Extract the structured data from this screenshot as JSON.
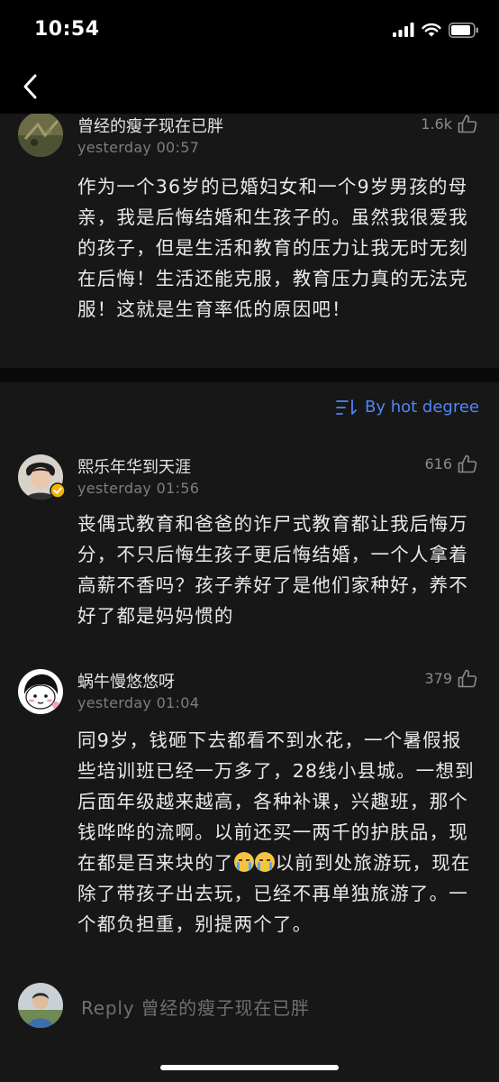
{
  "status": {
    "time": "10:54"
  },
  "nav": {
    "back_icon": "chevron-left-icon"
  },
  "parent_comment": {
    "author": "曾经的瘦子现在已胖",
    "date": "yesterday 00:57",
    "likes": "1.6k",
    "text": "作为一个36岁的已婚妇女和一个9岁男孩的母亲，我是后悔结婚和生孩子的。虽然我很爱我的孩子，但是生活和教育的压力让我无时无刻在后悔！生活还能克服，教育压力真的无法克服！这就是生育率低的原因吧！"
  },
  "sort": {
    "label": "By hot degree",
    "icon": "sort-icon"
  },
  "replies": [
    {
      "author": "熙乐年华到天涯",
      "date": "yesterday 01:56",
      "likes": "616",
      "text": "丧偶式教育和爸爸的诈尸式教育都让我后悔万分，不只后悔生孩子更后悔结婚，一个人拿着高薪不香吗？孩子养好了是他们家种好，养不好了都是妈妈惯的"
    },
    {
      "author": "蜗牛慢悠悠呀",
      "date": "yesterday 01:04",
      "likes": "379",
      "text_part1": "同9岁，钱砸下去都看不到水花，一个暑假报些培训班已经一万多了，28线小县城。一想到后面年级越来越高，各种补课，兴趣班，那个钱哗哗的流啊。以前还买一两千的护肤品，现在都是百来块的了",
      "text_part2": "以前到处旅游玩，现在除了带孩子出去玩，已经不再单独旅游了。一个都负担重，别提两个了。",
      "emoji": "loudly-crying-face-icon"
    }
  ],
  "reply_bar": {
    "placeholder": "Reply 曾经的瘦子现在已胖"
  },
  "colors": {
    "background": "#000000",
    "card": "#171717",
    "accent": "#4f86f7",
    "badge": "#f5b400"
  }
}
